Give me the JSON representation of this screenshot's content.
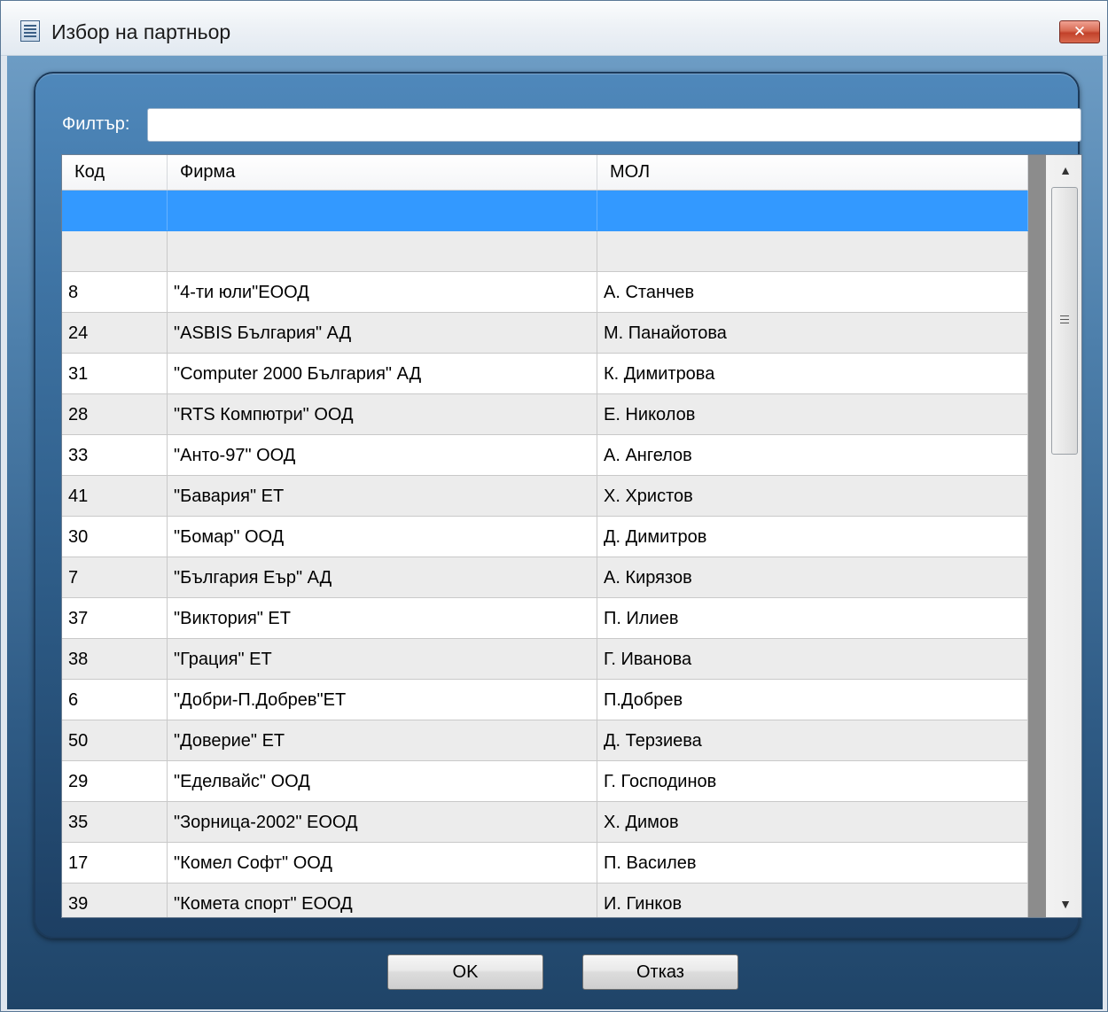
{
  "window": {
    "title": "Избор на партньор",
    "close_label": "✕"
  },
  "filter": {
    "label": "Филтър:",
    "value": "",
    "placeholder": ""
  },
  "grid": {
    "columns": [
      "Код",
      "Фирма",
      "МОЛ"
    ],
    "rows": [
      {
        "code": "",
        "firm": "",
        "mol": "",
        "selected": true
      },
      {
        "code": "",
        "firm": "",
        "mol": ""
      },
      {
        "code": "8",
        "firm": "\"4-ти юли\"ЕООД",
        "mol": "А. Станчев"
      },
      {
        "code": "24",
        "firm": "\"ASBIS България\" АД",
        "mol": "М. Панайотова"
      },
      {
        "code": "31",
        "firm": "\"Computer 2000  България\" АД",
        "mol": "К. Димитрова"
      },
      {
        "code": "28",
        "firm": "\"RTS Компютри\" ООД",
        "mol": "Е. Николов"
      },
      {
        "code": "33",
        "firm": "\"Анто-97\" ООД",
        "mol": "А. Ангелов"
      },
      {
        "code": "41",
        "firm": "\"Бавария\" ЕТ",
        "mol": "Х. Христов"
      },
      {
        "code": "30",
        "firm": "\"Бомар\" ООД",
        "mol": "Д. Димитров"
      },
      {
        "code": "7",
        "firm": "\"България Еър\" АД",
        "mol": "А. Кирязов"
      },
      {
        "code": "37",
        "firm": "\"Виктория\" ЕТ",
        "mol": "П. Илиев"
      },
      {
        "code": "38",
        "firm": "\"Грация\" ЕТ",
        "mol": "Г. Иванова"
      },
      {
        "code": "6",
        "firm": "\"Добри-П.Добрев\"ЕТ",
        "mol": "П.Добрев"
      },
      {
        "code": "50",
        "firm": "\"Доверие\" ЕТ",
        "mol": "Д. Терзиева"
      },
      {
        "code": "29",
        "firm": "\"Еделвайс\" ООД",
        "mol": "Г. Господинов"
      },
      {
        "code": "35",
        "firm": "\"Зорница-2002\" ЕООД",
        "mol": "Х. Димов"
      },
      {
        "code": "17",
        "firm": "\"Комел Софт\" ООД",
        "mol": "П. Василев"
      },
      {
        "code": "39",
        "firm": "\"Комета спорт\" ЕООД",
        "mol": "И. Гинков"
      }
    ]
  },
  "scrollbar": {
    "up_icon": "▲",
    "down_icon": "▼"
  },
  "buttons": {
    "ok_label": "OK",
    "cancel_label": "Отказ"
  },
  "colors": {
    "selection": "#3399ff",
    "panel_blue": "#3e73a3",
    "close_red": "#c2412a"
  }
}
